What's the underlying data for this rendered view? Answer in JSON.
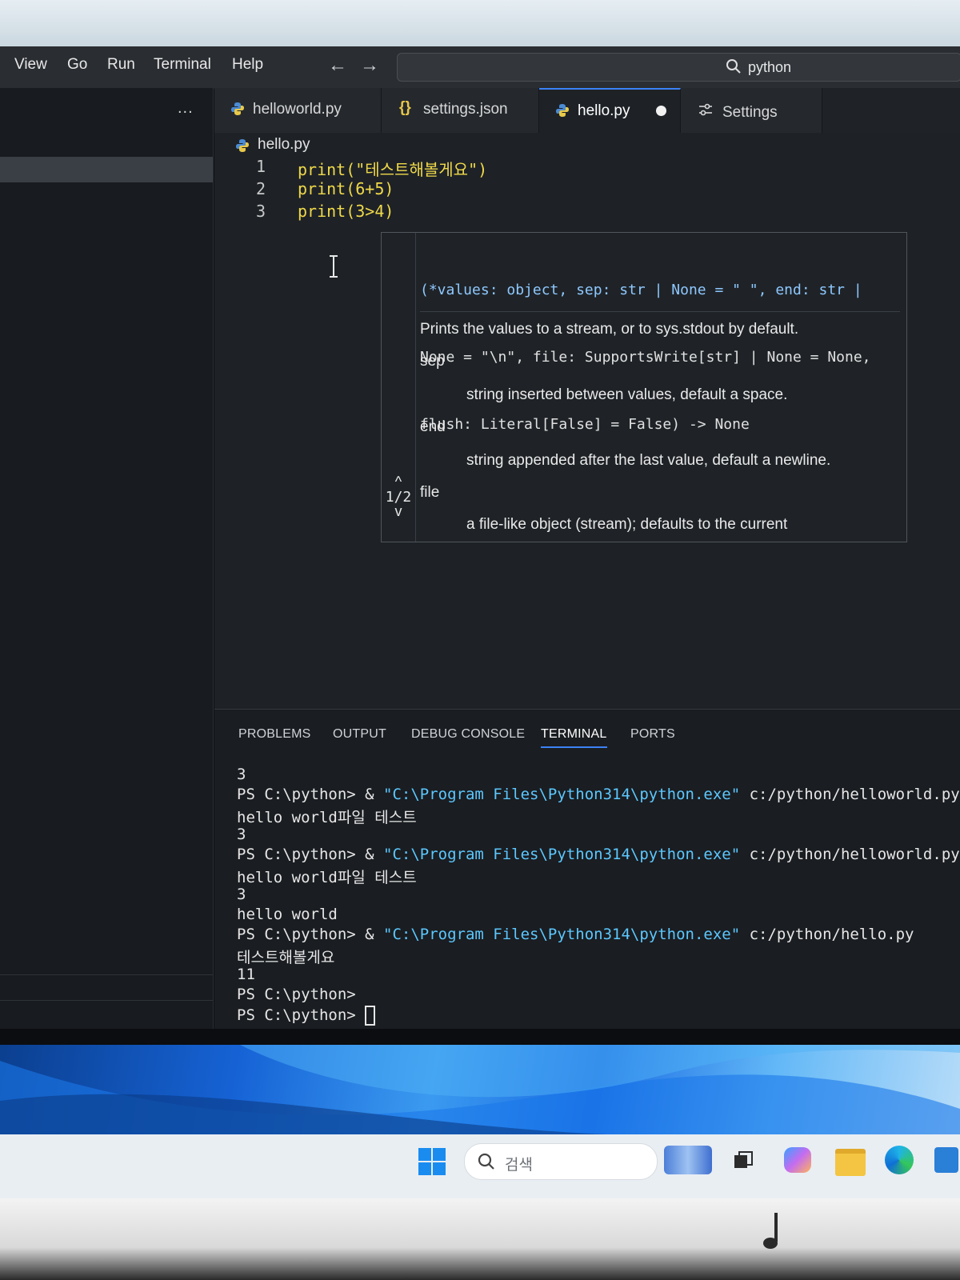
{
  "menu": {
    "items": [
      "View",
      "Go",
      "Run",
      "Terminal",
      "Help"
    ],
    "search_text": "python"
  },
  "sidebar": {
    "more_label": "..."
  },
  "tabs": [
    {
      "label": "helloworld.py",
      "icon": "python-icon",
      "active": false
    },
    {
      "label": "settings.json",
      "icon": "json-braces-icon",
      "active": false
    },
    {
      "label": "hello.py",
      "icon": "python-icon",
      "active": true,
      "unsaved": true
    },
    {
      "label": "Settings",
      "icon": "settings-sliders-icon",
      "active": false
    }
  ],
  "editor": {
    "breadcrumb": "hello.py",
    "lines": [
      {
        "n": "1",
        "code": "print(\"테스트해볼게요\")"
      },
      {
        "n": "2",
        "code": "print(6+5)"
      },
      {
        "n": "3",
        "code": "print(3>4)"
      }
    ]
  },
  "hover": {
    "signature": [
      "(*values: object, sep: str | None = \" \", end: str |",
      "None = \"\\n\", file: SupportsWrite[str] | None = None,",
      "flush: Literal[False] = False) -> None"
    ],
    "pager": "1/2",
    "doc": {
      "summary": "Prints the values to a stream, or to sys.stdout by default.",
      "sep": "sep",
      "sep_desc": "string inserted between values, default a space.",
      "end": "end",
      "end_desc": "string appended after the last value, default a newline.",
      "file": "file",
      "file_desc": "a file-like object (stream); defaults to the current"
    }
  },
  "panel": {
    "tabs": [
      "PROBLEMS",
      "OUTPUT",
      "DEBUG CONSOLE",
      "TERMINAL",
      "PORTS"
    ],
    "active_tab": "TERMINAL",
    "terminal": {
      "l1": "3",
      "l2_prompt": "PS C:\\python> & ",
      "l2_exe": "\"C:\\Program Files\\Python314\\python.exe\"",
      "l2_file": " c:/python/helloworld.py",
      "l3": "hello world파일 테스트",
      "l4": "3",
      "l5_prompt": "PS C:\\python> & ",
      "l5_exe": "\"C:\\Program Files\\Python314\\python.exe\"",
      "l5_file": " c:/python/helloworld.py",
      "l6": "hello world파일 테스트",
      "l7": "3",
      "l8": "hello world",
      "l9_prompt": "PS C:\\python> & ",
      "l9_exe": "\"C:\\Program Files\\Python314\\python.exe\"",
      "l9_file": " c:/python/hello.py",
      "l10": "테스트해볼게요",
      "l11": "11",
      "l12": "PS C:\\python>",
      "l13": "PS C:\\python> "
    }
  },
  "taskbar": {
    "search_placeholder": "검색"
  },
  "colors": {
    "accent": "#3b82f6",
    "string_yellow": "#f0d94a",
    "path_cyan": "#5cc8ff"
  }
}
